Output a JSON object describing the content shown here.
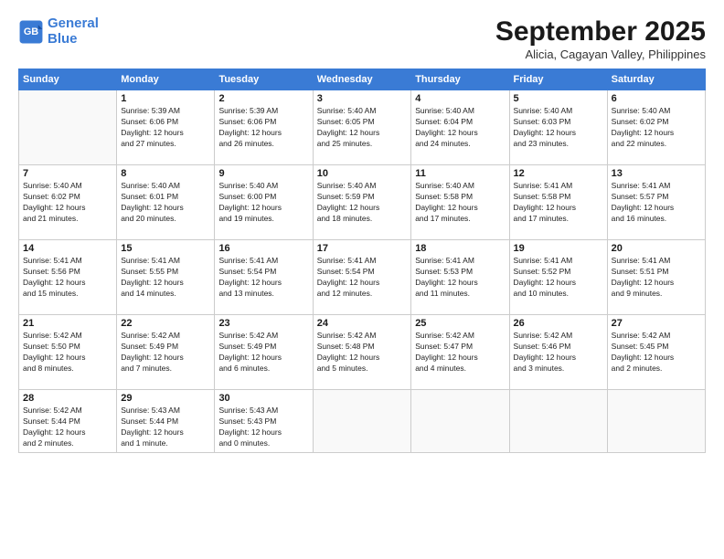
{
  "header": {
    "logo_line1": "General",
    "logo_line2": "Blue",
    "month_title": "September 2025",
    "location": "Alicia, Cagayan Valley, Philippines"
  },
  "weekdays": [
    "Sunday",
    "Monday",
    "Tuesday",
    "Wednesday",
    "Thursday",
    "Friday",
    "Saturday"
  ],
  "weeks": [
    [
      {
        "day": "",
        "info": ""
      },
      {
        "day": "1",
        "info": "Sunrise: 5:39 AM\nSunset: 6:06 PM\nDaylight: 12 hours\nand 27 minutes."
      },
      {
        "day": "2",
        "info": "Sunrise: 5:39 AM\nSunset: 6:06 PM\nDaylight: 12 hours\nand 26 minutes."
      },
      {
        "day": "3",
        "info": "Sunrise: 5:40 AM\nSunset: 6:05 PM\nDaylight: 12 hours\nand 25 minutes."
      },
      {
        "day": "4",
        "info": "Sunrise: 5:40 AM\nSunset: 6:04 PM\nDaylight: 12 hours\nand 24 minutes."
      },
      {
        "day": "5",
        "info": "Sunrise: 5:40 AM\nSunset: 6:03 PM\nDaylight: 12 hours\nand 23 minutes."
      },
      {
        "day": "6",
        "info": "Sunrise: 5:40 AM\nSunset: 6:02 PM\nDaylight: 12 hours\nand 22 minutes."
      }
    ],
    [
      {
        "day": "7",
        "info": "Sunrise: 5:40 AM\nSunset: 6:02 PM\nDaylight: 12 hours\nand 21 minutes."
      },
      {
        "day": "8",
        "info": "Sunrise: 5:40 AM\nSunset: 6:01 PM\nDaylight: 12 hours\nand 20 minutes."
      },
      {
        "day": "9",
        "info": "Sunrise: 5:40 AM\nSunset: 6:00 PM\nDaylight: 12 hours\nand 19 minutes."
      },
      {
        "day": "10",
        "info": "Sunrise: 5:40 AM\nSunset: 5:59 PM\nDaylight: 12 hours\nand 18 minutes."
      },
      {
        "day": "11",
        "info": "Sunrise: 5:40 AM\nSunset: 5:58 PM\nDaylight: 12 hours\nand 17 minutes."
      },
      {
        "day": "12",
        "info": "Sunrise: 5:41 AM\nSunset: 5:58 PM\nDaylight: 12 hours\nand 17 minutes."
      },
      {
        "day": "13",
        "info": "Sunrise: 5:41 AM\nSunset: 5:57 PM\nDaylight: 12 hours\nand 16 minutes."
      }
    ],
    [
      {
        "day": "14",
        "info": "Sunrise: 5:41 AM\nSunset: 5:56 PM\nDaylight: 12 hours\nand 15 minutes."
      },
      {
        "day": "15",
        "info": "Sunrise: 5:41 AM\nSunset: 5:55 PM\nDaylight: 12 hours\nand 14 minutes."
      },
      {
        "day": "16",
        "info": "Sunrise: 5:41 AM\nSunset: 5:54 PM\nDaylight: 12 hours\nand 13 minutes."
      },
      {
        "day": "17",
        "info": "Sunrise: 5:41 AM\nSunset: 5:54 PM\nDaylight: 12 hours\nand 12 minutes."
      },
      {
        "day": "18",
        "info": "Sunrise: 5:41 AM\nSunset: 5:53 PM\nDaylight: 12 hours\nand 11 minutes."
      },
      {
        "day": "19",
        "info": "Sunrise: 5:41 AM\nSunset: 5:52 PM\nDaylight: 12 hours\nand 10 minutes."
      },
      {
        "day": "20",
        "info": "Sunrise: 5:41 AM\nSunset: 5:51 PM\nDaylight: 12 hours\nand 9 minutes."
      }
    ],
    [
      {
        "day": "21",
        "info": "Sunrise: 5:42 AM\nSunset: 5:50 PM\nDaylight: 12 hours\nand 8 minutes."
      },
      {
        "day": "22",
        "info": "Sunrise: 5:42 AM\nSunset: 5:49 PM\nDaylight: 12 hours\nand 7 minutes."
      },
      {
        "day": "23",
        "info": "Sunrise: 5:42 AM\nSunset: 5:49 PM\nDaylight: 12 hours\nand 6 minutes."
      },
      {
        "day": "24",
        "info": "Sunrise: 5:42 AM\nSunset: 5:48 PM\nDaylight: 12 hours\nand 5 minutes."
      },
      {
        "day": "25",
        "info": "Sunrise: 5:42 AM\nSunset: 5:47 PM\nDaylight: 12 hours\nand 4 minutes."
      },
      {
        "day": "26",
        "info": "Sunrise: 5:42 AM\nSunset: 5:46 PM\nDaylight: 12 hours\nand 3 minutes."
      },
      {
        "day": "27",
        "info": "Sunrise: 5:42 AM\nSunset: 5:45 PM\nDaylight: 12 hours\nand 2 minutes."
      }
    ],
    [
      {
        "day": "28",
        "info": "Sunrise: 5:42 AM\nSunset: 5:44 PM\nDaylight: 12 hours\nand 2 minutes."
      },
      {
        "day": "29",
        "info": "Sunrise: 5:43 AM\nSunset: 5:44 PM\nDaylight: 12 hours\nand 1 minute."
      },
      {
        "day": "30",
        "info": "Sunrise: 5:43 AM\nSunset: 5:43 PM\nDaylight: 12 hours\nand 0 minutes."
      },
      {
        "day": "",
        "info": ""
      },
      {
        "day": "",
        "info": ""
      },
      {
        "day": "",
        "info": ""
      },
      {
        "day": "",
        "info": ""
      }
    ]
  ]
}
